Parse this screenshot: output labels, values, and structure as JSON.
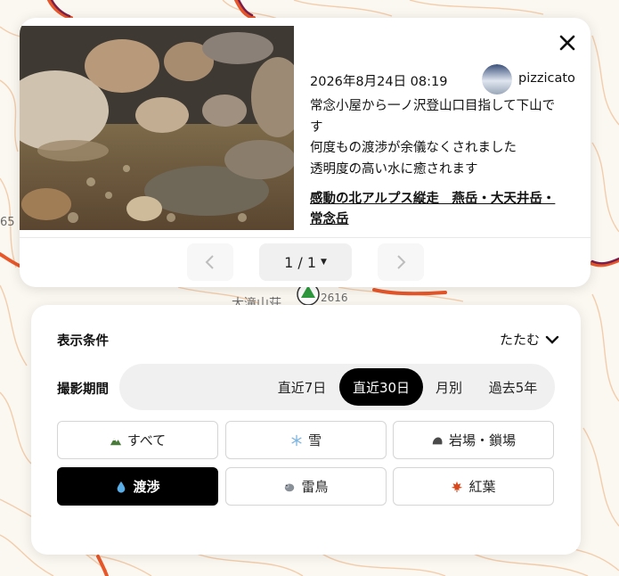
{
  "map": {
    "labels": [
      "65",
      "大滝山荘",
      "2616"
    ]
  },
  "photo_card": {
    "post_date": "2026年8月24日 08:19",
    "username": "pizzicato",
    "body_lines": [
      "常念小屋から一ノ沢登山口目指して下山で",
      "す",
      "何度もの渡渉が余儀なくされました",
      "透明度の高い水に癒されます"
    ],
    "link_text_1": "感動の北アルプス縦走　燕岳・大天井岳・",
    "link_text_2": "常念岳",
    "page_indicator": "1 / 1",
    "close_icon": "close-icon",
    "prev_icon": "chevron-left-icon",
    "next_icon": "chevron-right-icon"
  },
  "filter": {
    "title": "表示条件",
    "collapse_label": "たたむ",
    "period_label": "撮影期間",
    "period_options": [
      "直近7日",
      "直近30日",
      "月別",
      "過去5年"
    ],
    "period_selected": "直近30日",
    "categories": [
      {
        "label": "すべて",
        "icon": "mountain-icon"
      },
      {
        "label": "雪",
        "icon": "snowflake-icon"
      },
      {
        "label": "岩場・鎖場",
        "icon": "rock-icon"
      },
      {
        "label": "渡渉",
        "icon": "water-drop-icon"
      },
      {
        "label": "雷鳥",
        "icon": "ptarmigan-icon"
      },
      {
        "label": "紅葉",
        "icon": "maple-leaf-icon"
      }
    ],
    "category_selected": "渡渉"
  },
  "colors": {
    "contour": "#f2b98a",
    "trail": "#e8572a",
    "trail_dark": "#7a1f4a",
    "active": "#000000"
  }
}
